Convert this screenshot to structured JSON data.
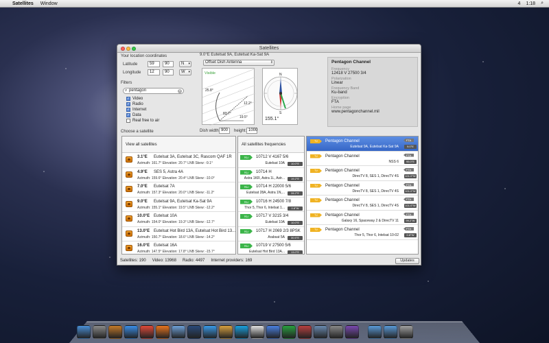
{
  "menubar": {
    "apple": "",
    "app": "Satellites",
    "menus": [
      "Window"
    ],
    "battery": "4",
    "time": "1:18"
  },
  "window": {
    "title": "Satellites"
  },
  "location": {
    "heading": "Your location coordinates",
    "lat_label": "Latitude",
    "lat_deg": "59",
    "lat_min": "90",
    "lat_dir": "N",
    "lon_label": "Longitude",
    "lon_deg": "12",
    "lon_min": "90",
    "lon_dir": "W"
  },
  "filters": {
    "heading": "Filters",
    "search": "pentagon",
    "items": [
      {
        "label": "Video",
        "checked": true
      },
      {
        "label": "Radio",
        "checked": true
      },
      {
        "label": "Internet",
        "checked": true
      },
      {
        "label": "Data",
        "checked": true
      },
      {
        "label": "Real free to air",
        "checked": false
      }
    ]
  },
  "choose_label": "Choose a satellite",
  "current": {
    "title": "9.0°E Eutelsat 9A, Eutelsat Ka-Sat 9A",
    "antenna": "Offset Dish Antenna",
    "dish_width_label": "Dish width:",
    "dish_width": "900",
    "height_label": "height:",
    "height": "1000",
    "visible": "Visible",
    "angle1": "25.8°",
    "angle2": "83.7°",
    "angle3": "12.2°",
    "angle4": "19.5°",
    "azimuth": "155.1°",
    "compass": {
      "n": "N",
      "s": "S",
      "e": "",
      "w": ""
    }
  },
  "info": {
    "name": "Pentagon Channel",
    "freq_label": "Frequency",
    "freq": "12418 V 27500 3/4",
    "pol_label": "Polarization",
    "pol": "Linear",
    "band_label": "Frequency Band",
    "band": "Ku-band",
    "enc_label": "Encryption",
    "enc": "FTA",
    "home_label": "Home page",
    "home": "www.pentagonchannel.mil"
  },
  "sat_panel": {
    "header": "View all satellites",
    "rows": [
      {
        "pos": "3.1°E",
        "name": "Eutelsat 3A, Eutelsat 3C, Rascom QAF 1R",
        "det": "Azimuth: 161.7°   Elevation: 20.7°   LNB Skew: -9.1°"
      },
      {
        "pos": "4.9°E",
        "name": "SES 5, Astra 4A",
        "det": "Azimuth: 159.6°   Elevation: 20.4°   LNB Skew: -10.0°"
      },
      {
        "pos": "7.0°E",
        "name": "Eutelsat 7A",
        "det": "Azimuth: 157.3°   Elevation: 20.0°   LNB Skew: -11.2°"
      },
      {
        "pos": "9.0°E",
        "name": "Eutelsat 9A, Eutelsat Ka-Sat 9A",
        "det": "Azimuth: 155.1°   Elevation: 19.5°   LNB Skew: -12.2°"
      },
      {
        "pos": "10.0°E",
        "name": "Eutelsat 10A",
        "det": "Azimuth: 154.0°   Elevation: 19.3°   LNB Skew: -12.7°"
      },
      {
        "pos": "13.0°E",
        "name": "Eutelsat Hot Bird 13A, Eutelsat Hot Bird 13...",
        "det": "Azimuth: 150.7°   Elevation: 18.6°   LNB Skew: -14.2°"
      },
      {
        "pos": "16.0°E",
        "name": "Eutelsat 16A",
        "det": "Azimuth: 147.5°   Elevation: 17.8°   LNB Skew: -15.7°"
      }
    ]
  },
  "freq_panel": {
    "header": "All satellites frequencies",
    "rows": [
      {
        "tag": "Ku",
        "freq": "10712 V 4167 5/6",
        "sat": "Eutelsat 10A",
        "badge": "10.0°E"
      },
      {
        "tag": "Ku",
        "freq": "10714 H",
        "sat": "Astra 1KR, Astra 1L, Astr...",
        "badge": "19.2°E"
      },
      {
        "tag": "Ku",
        "freq": "10714 H 22000 5/6",
        "sat": "Eutelsat 28A, Astra 1N,...",
        "badge": "28.2°E"
      },
      {
        "tag": "Ku",
        "freq": "10716 H 24500 7/8",
        "sat": "Thor 5, Thor 6, Intelsat 1...",
        "badge": "0.8°W"
      },
      {
        "tag": "Ku",
        "freq": "10717 V 3215 3/4",
        "sat": "Eutelsat 10A",
        "badge": "10.0°E"
      },
      {
        "tag": "Ku",
        "freq": "10717 H 2069 2/3 8PSK",
        "sat": "Arabsat 5A",
        "badge": "30.5°E"
      },
      {
        "tag": "Ku",
        "freq": "10719 V 27500 5/6",
        "sat": "Eutelsat Hot Bird 13A...",
        "badge": "13.0°E"
      }
    ]
  },
  "chan_panel": {
    "rows": [
      {
        "tag": "TV",
        "name": "Pentagon Channel",
        "sat": "Eutelsat 9A, Eutelsat Ka-Sat 9A",
        "badge": "9.0°E",
        "fta": "FTA",
        "selected": true
      },
      {
        "tag": "TV",
        "name": "Pentagon Channel",
        "sat": "NSS 6",
        "badge": "95.0°E",
        "fta": "FTA",
        "selected": false
      },
      {
        "tag": "TV",
        "name": "Pentagon Channel",
        "sat": "DirecTV 8, SES 1, DirecTV 4S",
        "badge": "101.0°W",
        "fta": "FTA",
        "selected": false
      },
      {
        "tag": "TV",
        "name": "Pentagon Channel",
        "sat": "DirecTV 8, SES 1, DirecTV 4S",
        "badge": "101.0°W",
        "fta": "FTA",
        "selected": false
      },
      {
        "tag": "TV",
        "name": "Pentagon Channel",
        "sat": "DirecTV 8, SES 1, DirecTV 4S",
        "badge": "101.0°W",
        "fta": "FTA",
        "selected": false
      },
      {
        "tag": "TV",
        "name": "Pentagon Channel",
        "sat": "Galaxy 16, Spaceway 2 & DirecTV 11",
        "badge": "99.2°W",
        "fta": "FTA",
        "selected": false
      },
      {
        "tag": "TV",
        "name": "Pentagon Channel",
        "sat": "Thor 5, Thor 6, Intelsat 10-02",
        "badge": "0.8°W",
        "fta": "FTA",
        "selected": false
      }
    ]
  },
  "status": {
    "satellites": "Satellites: 190",
    "video": "Video: 13968",
    "radio": "Radio: 4497",
    "internet": "Internet providers: 169",
    "updates": "Updates"
  },
  "dock": [
    "finder",
    "launchpad",
    "preview",
    "app-store",
    "chrome",
    "firefox",
    "mail",
    "quicktime",
    "safari",
    "ibooks",
    "skype",
    "calendar",
    "itunes",
    "utorrent",
    "photo-booth",
    "iphoto",
    "system-prefs",
    "satellites",
    "folder",
    "downloads",
    "trash"
  ]
}
